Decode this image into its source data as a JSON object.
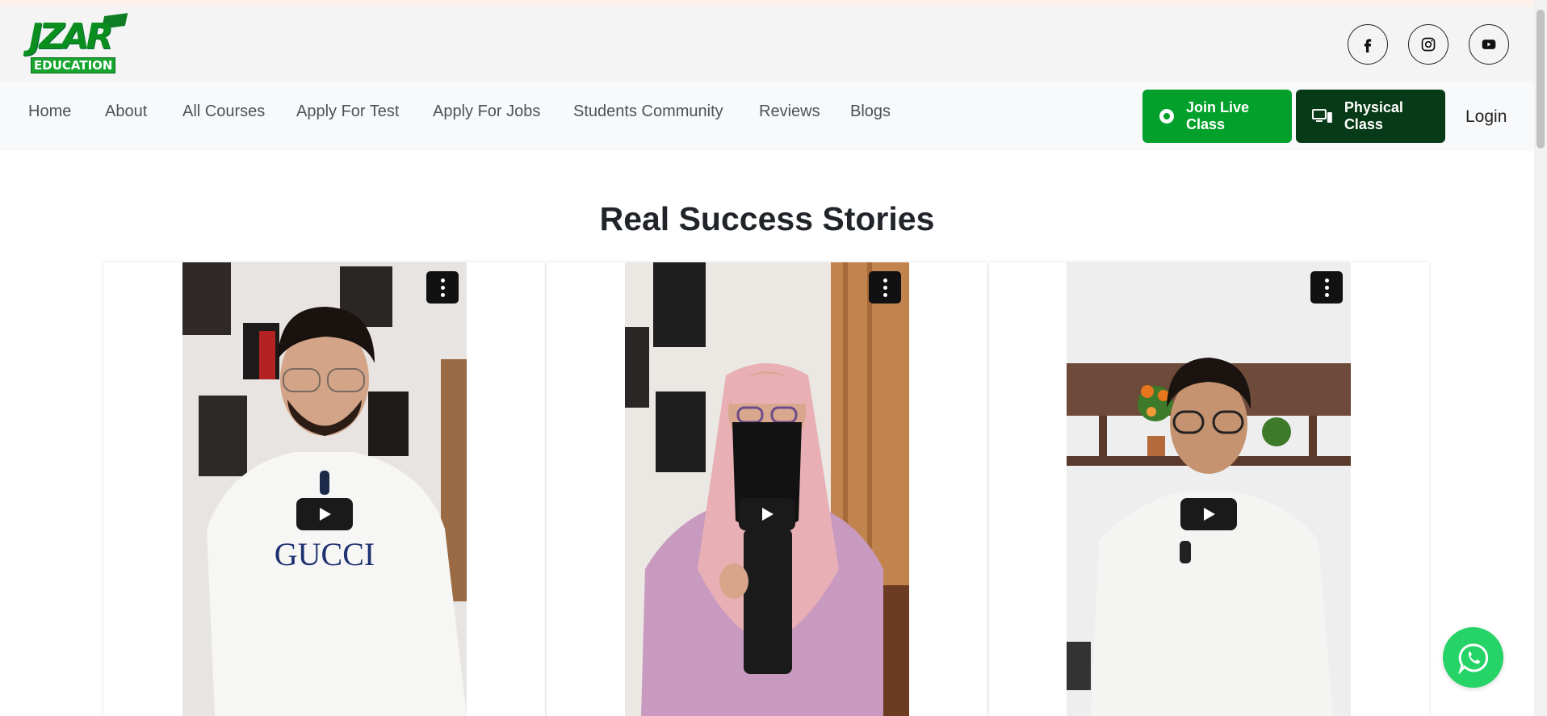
{
  "brand": {
    "logo_top": "JZAR",
    "logo_bottom": "EDUCATION",
    "primary_color": "#03a12b",
    "dark_color": "#073a16"
  },
  "social": [
    {
      "name": "facebook-icon"
    },
    {
      "name": "instagram-icon"
    },
    {
      "name": "youtube-icon"
    }
  ],
  "nav": {
    "items": [
      {
        "label": "Home"
      },
      {
        "label": "About"
      },
      {
        "label": "All Courses"
      },
      {
        "label": "Apply For Test"
      },
      {
        "label": "Apply For Jobs"
      },
      {
        "label": "Students Community"
      },
      {
        "label": "Reviews"
      },
      {
        "label": "Blogs"
      }
    ],
    "join_live_label": "Join Live Class",
    "physical_label": "Physical Class",
    "login_label": "Login"
  },
  "section": {
    "title": "Real Success Stories"
  },
  "videos": [
    {
      "id": "video-1",
      "shirt_text": "GUCCI"
    },
    {
      "id": "video-2"
    },
    {
      "id": "video-3"
    }
  ]
}
